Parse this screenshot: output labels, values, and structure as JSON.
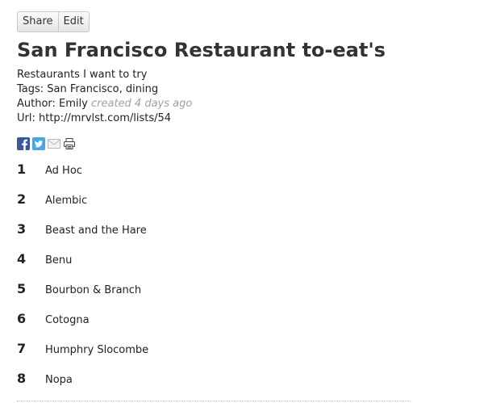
{
  "toolbar": {
    "share_label": "Share",
    "edit_label": "Edit"
  },
  "list": {
    "title": "San Francisco Restaurant to-eat's",
    "description": "Restaurants I want to try",
    "tags_line": "Tags: San Francisco, dining",
    "author_line": "Author: Emily",
    "created": "created 4 days ago",
    "url_line": "Url: http://mrvlst.com/lists/54"
  },
  "share_icons": [
    "facebook-icon",
    "twitter-icon",
    "email-icon",
    "print-icon"
  ],
  "colors": {
    "facebook": "#3b5998",
    "twitter": "#4ba6e0",
    "muted": "#a0a0a0"
  },
  "items": [
    {
      "number": "1",
      "name": "Ad Hoc"
    },
    {
      "number": "2",
      "name": "Alembic"
    },
    {
      "number": "3",
      "name": "Beast and the Hare"
    },
    {
      "number": "4",
      "name": "Benu"
    },
    {
      "number": "5",
      "name": "Bourbon & Branch"
    },
    {
      "number": "6",
      "name": "Cotogna"
    },
    {
      "number": "7",
      "name": "Humphry Slocombe"
    },
    {
      "number": "8",
      "name": "Nopa"
    }
  ]
}
